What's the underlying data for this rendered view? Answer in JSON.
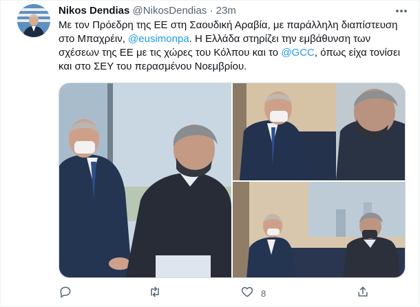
{
  "author": {
    "name": "Nikos Dendias",
    "handle": "@NikosDendias",
    "separator": "·",
    "time": "23m"
  },
  "tweet": {
    "segments": [
      {
        "text": "Με τον Πρόεδρη της ΕΕ στη Σαουδική Αραβία, με παράλληλη διαπίστευση",
        "link": false
      },
      {
        "text": "στο Μπαχρέιν, ",
        "link": false
      },
      {
        "text": "@eusimonpa",
        "link": true
      },
      {
        "text": ". Η Ελλάδα στηρίζει την εμβάθυνση των",
        "link": false
      },
      {
        "text": "σχέσεων της ΕΕ με τις χώρες του Κόλπου και το ",
        "link": false
      },
      {
        "text": "@GCC",
        "link": true
      },
      {
        "text": ", όπως είχα τονίσει",
        "link": false
      },
      {
        "text": "και στο ΣΕΥ του περασμένου Νοεμβρίου.",
        "link": false
      }
    ]
  },
  "actions": {
    "reply_count": "",
    "retweet_count": "",
    "like_count": "8",
    "share_count": ""
  },
  "icons": [
    "avatar",
    "more-icon",
    "reply-icon",
    "retweet-icon",
    "like-icon",
    "share-icon"
  ],
  "colors": {
    "link": "#1d9bf0",
    "secondary_text": "#536471",
    "border": "#cfd9de"
  }
}
